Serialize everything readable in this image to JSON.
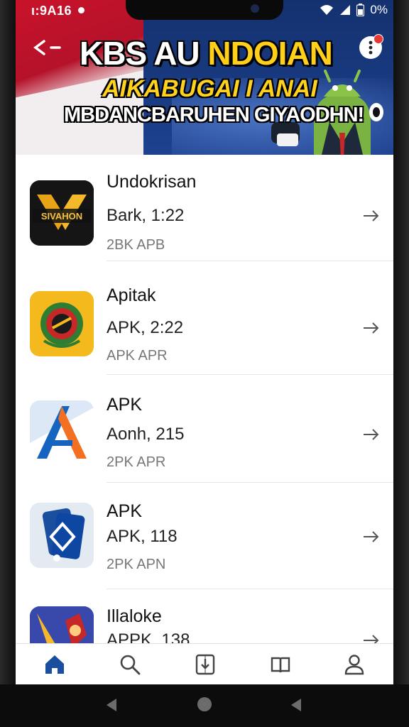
{
  "status_bar": {
    "time": "ι:9Α16",
    "battery": "0%"
  },
  "banner": {
    "title_white": "KBS AU ",
    "title_yellow": "NDOIAN",
    "subtitle": "AIKABUGAI I ANAI",
    "tagline": "MBDANCBARUHEN GIYAODHN!"
  },
  "apps": [
    {
      "name": "Undokrisan",
      "version": "Bark, 1:22",
      "meta": "2BK  APB",
      "icon": "sivahon-logo-icon",
      "icon_text": "SIVAHON"
    },
    {
      "name": "Apitak",
      "version": "APK, 2:22",
      "meta": "APK  APR",
      "icon": "emblem-icon"
    },
    {
      "name": "APK",
      "version": "Aonh, 215",
      "meta": "2PK  APR",
      "icon": "a-logo-icon"
    },
    {
      "name": "APK",
      "version": "APK, 118",
      "meta": "2PK  APN",
      "icon": "cards-icon"
    },
    {
      "name": "Illaloke",
      "version": "APPK, 138",
      "meta": "",
      "icon": "game-art-icon"
    }
  ],
  "colors": {
    "accent": "#1a4fa0",
    "banner_red": "#c8132a",
    "banner_blue": "#14316f",
    "title_yellow": "#ffcf1a"
  },
  "nav": [
    {
      "icon": "home-icon",
      "active": true
    },
    {
      "icon": "search-icon",
      "active": false
    },
    {
      "icon": "install-icon",
      "active": false
    },
    {
      "icon": "library-icon",
      "active": false
    },
    {
      "icon": "profile-icon",
      "active": false
    }
  ]
}
